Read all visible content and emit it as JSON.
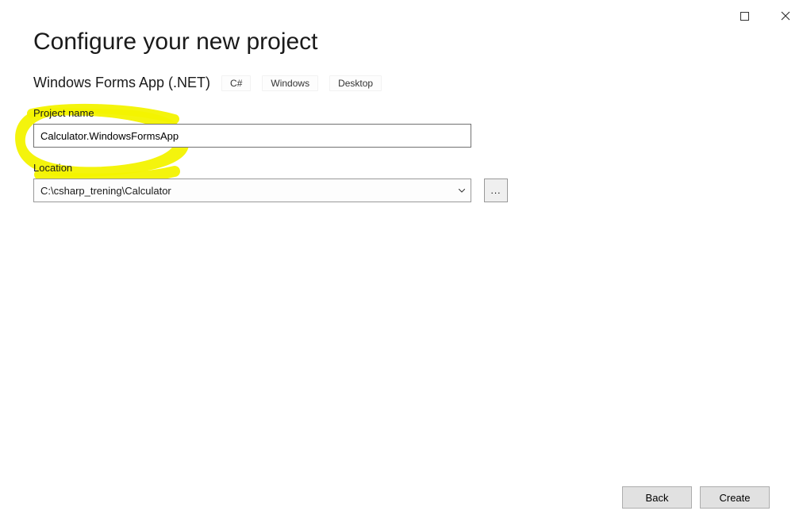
{
  "window": {
    "restore_icon": "restore",
    "close_icon": "close"
  },
  "header": {
    "title": "Configure your new project",
    "subtitle": "Windows Forms App (.NET)",
    "tags": [
      "C#",
      "Windows",
      "Desktop"
    ]
  },
  "fields": {
    "project_name_label": "Project name",
    "project_name_value": "Calculator.WindowsFormsApp",
    "location_label": "Location",
    "location_value": "C:\\csharp_trening\\Calculator",
    "browse_label": "..."
  },
  "footer": {
    "back_label": "Back",
    "create_label": "Create"
  }
}
